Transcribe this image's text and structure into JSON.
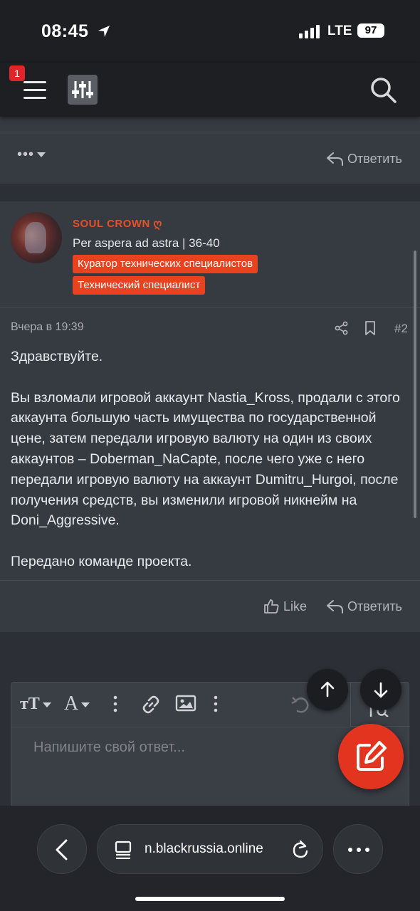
{
  "status": {
    "time": "08:45",
    "network": "LTE",
    "battery": "97"
  },
  "header": {
    "notification_count": "1"
  },
  "prev_post": {
    "reply_label": "Ответить"
  },
  "post": {
    "username": "SOUL CROWN ღ",
    "user_title": "Per aspera ad astra | 36-40",
    "banners": [
      "Куратор технических специалистов",
      "Технический специалист"
    ],
    "date": "Вчера в 19:39",
    "number": "#2",
    "paragraphs": [
      "Здравствуйте.",
      "Вы взломали игровой аккаунт Nastia_Kross, продали с этого аккаунта большую часть имущества по государственной цене, затем передали игровую валюту на один из своих аккаунтов – Doberman_NaCapte, после чего уже с него передали игровую валюту на аккаунт Dumitru_Hurgoi, после получения средств, вы изменили игровой никнейм на Doni_Aggressive.",
      "Передано команде проекта."
    ],
    "like_label": "Like",
    "reply_label": "Ответить"
  },
  "editor": {
    "placeholder": "Напишите свой ответ..."
  },
  "browser": {
    "url": "n.blackrussia.online"
  },
  "colors": {
    "accent": "#e8421f",
    "username": "#e8502a",
    "fab": "#e3341f",
    "badge": "#e0242a"
  }
}
